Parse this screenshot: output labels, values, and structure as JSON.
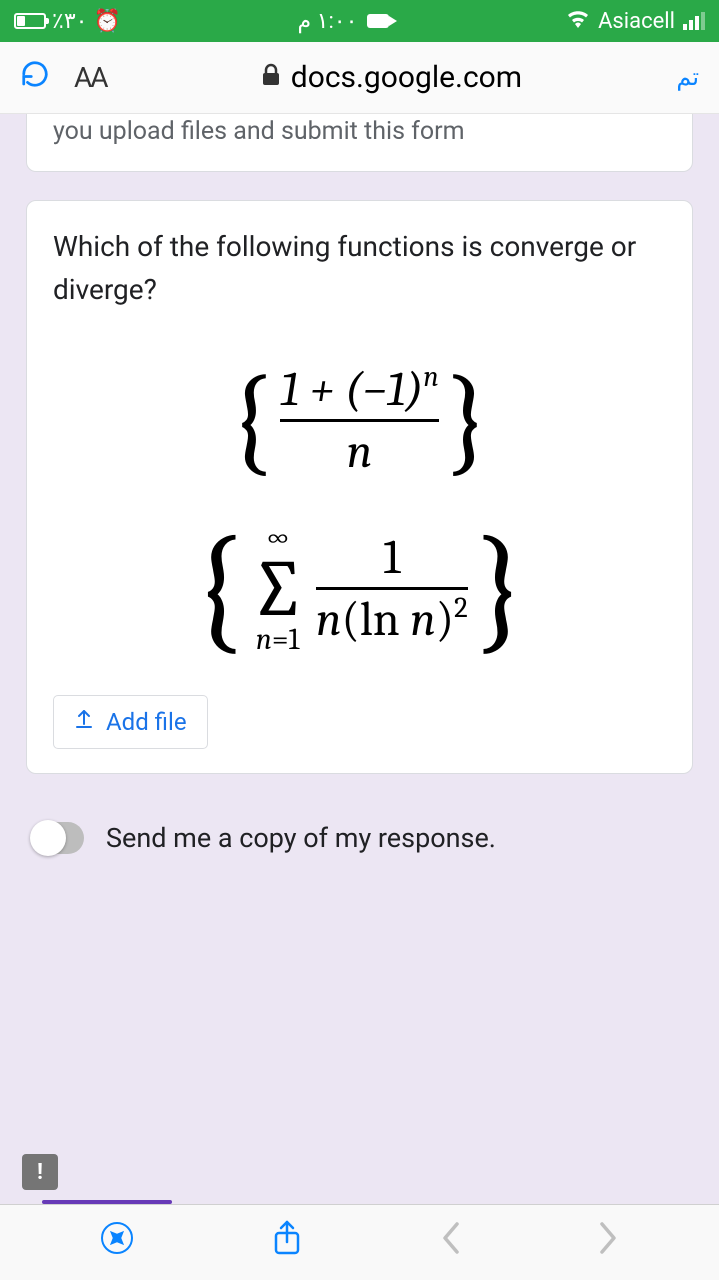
{
  "status": {
    "battery_pct": "٪٣٠",
    "alarm_indicator": "⏰",
    "time": "١:٠٠ م",
    "carrier": "Asiacell"
  },
  "urlbar": {
    "aa": "AA",
    "domain": "docs.google.com",
    "tabs_label": "تم"
  },
  "form": {
    "upload_hint": "you upload files and submit this form",
    "question": "Which of the following functions is converge or diverge?",
    "add_file_label": "Add file",
    "copy_response_label": "Send me a copy of my response."
  },
  "math": {
    "expr1_numerator_a": "1 + (−1)",
    "expr1_numerator_exp": "n",
    "expr1_denominator": "n",
    "sum_top": "∞",
    "sum_bottom_var": "n",
    "sum_bottom_eq": "=1",
    "expr2_numerator": "1",
    "expr2_denom_a": "n",
    "expr2_denom_b": "(ln ",
    "expr2_denom_c": "n",
    "expr2_denom_d": ")",
    "expr2_denom_exp": "2"
  },
  "feedback_fab": "!"
}
